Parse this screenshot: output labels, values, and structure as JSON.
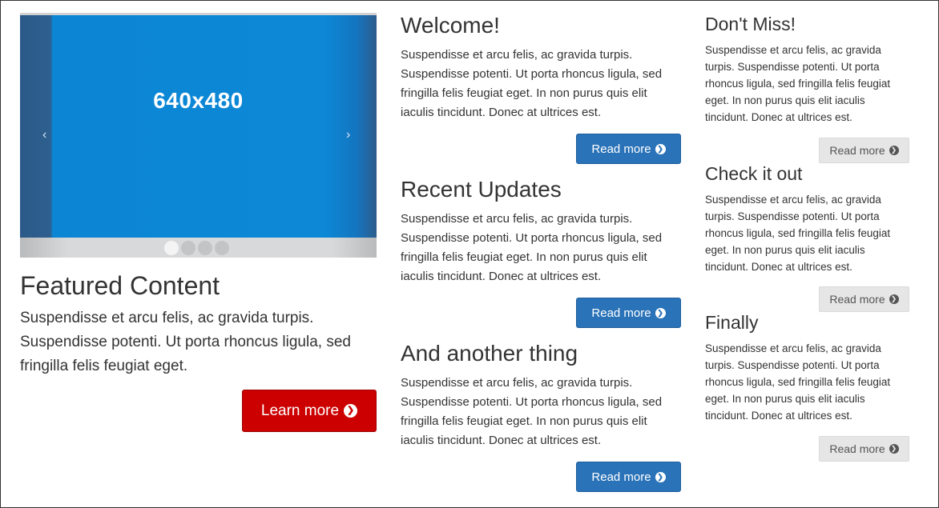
{
  "featured": {
    "carousel": {
      "slide_label": "640x480",
      "prev_arrow": "‹",
      "next_arrow": "›",
      "slide_count": 4,
      "active_index": 0
    },
    "title": "Featured Content",
    "text": "Suspendisse et arcu felis, ac gravida turpis. Suspendisse potenti. Ut porta rhoncus ligula, sed fringilla felis feugiat eget.",
    "button_label": "Learn more",
    "button_icon": "arrow-circle-right-icon",
    "button_color": "#cc0000"
  },
  "middle": {
    "sections": [
      {
        "title": "Welcome!",
        "text": "Suspendisse et arcu felis, ac gravida turpis. Suspendisse potenti. Ut porta rhoncus ligula, sed fringilla felis feugiat eget. In non purus quis elit iaculis tincidunt. Donec at ultrices est.",
        "button_label": "Read more"
      },
      {
        "title": "Recent Updates",
        "text": "Suspendisse et arcu felis, ac gravida turpis. Suspendisse potenti. Ut porta rhoncus ligula, sed fringilla felis feugiat eget. In non purus quis elit iaculis tincidunt. Donec at ultrices est.",
        "button_label": "Read more"
      },
      {
        "title": "And another thing",
        "text": "Suspendisse et arcu felis, ac gravida turpis. Suspendisse potenti. Ut porta rhoncus ligula, sed fringilla felis feugiat eget. In non purus quis elit iaculis tincidunt. Donec at ultrices est.",
        "button_label": "Read more"
      }
    ],
    "button_color": "#2a73b8"
  },
  "sidebar": {
    "sections": [
      {
        "title": "Don't Miss!",
        "text": "Suspendisse et arcu felis, ac gravida turpis. Suspendisse potenti. Ut porta rhoncus ligula, sed fringilla felis feugiat eget. In non purus quis elit iaculis tincidunt. Donec at ultrices est.",
        "button_label": "Read more"
      },
      {
        "title": "Check it out",
        "text": "Suspendisse et arcu felis, ac gravida turpis. Suspendisse potenti. Ut porta rhoncus ligula, sed fringilla felis feugiat eget. In non purus quis elit iaculis tincidunt. Donec at ultrices est.",
        "button_label": "Read more"
      },
      {
        "title": "Finally",
        "text": "Suspendisse et arcu felis, ac gravida turpis. Suspendisse potenti. Ut porta rhoncus ligula, sed fringilla felis feugiat eget. In non purus quis elit iaculis tincidunt. Donec at ultrices est.",
        "button_label": "Read more"
      }
    ],
    "button_color": "#e6e6e6"
  }
}
